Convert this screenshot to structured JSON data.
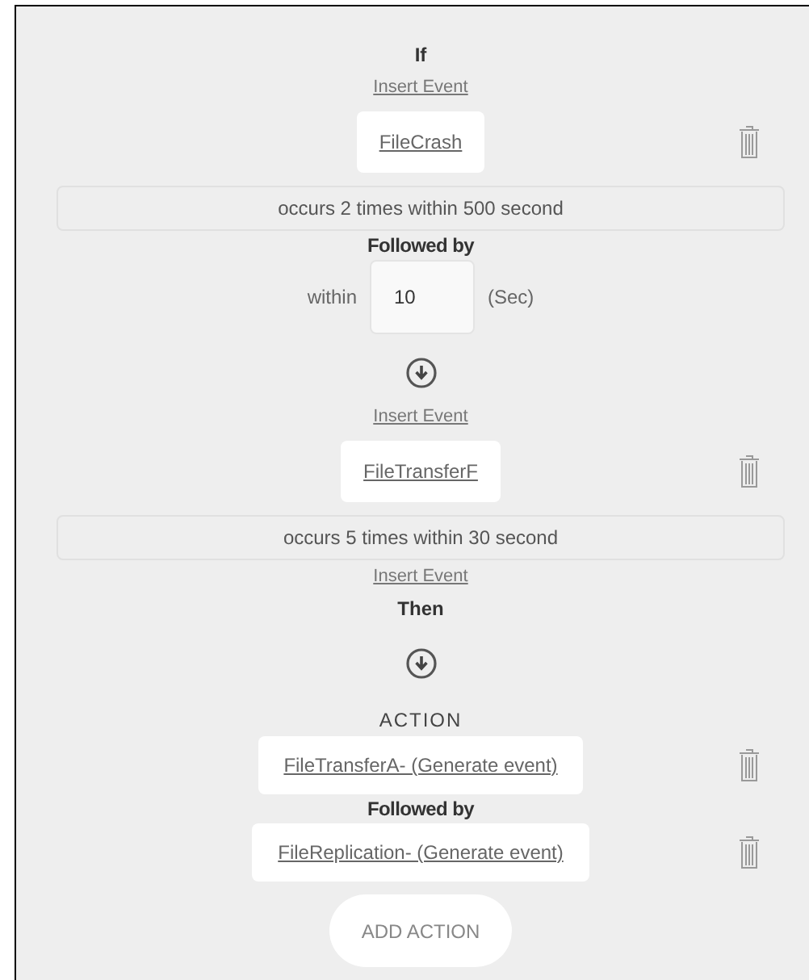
{
  "flow": [
    {
      "kind": "heading",
      "text": "If"
    },
    {
      "kind": "link",
      "text": "Insert Event"
    },
    {
      "kind": "event",
      "text": "FileCrash"
    },
    {
      "kind": "condition",
      "text": "occurs 2 times within 500 second"
    },
    {
      "kind": "subheading",
      "text": "Followed by"
    },
    {
      "kind": "delay",
      "label": "within",
      "value": "10",
      "unit": "(Sec)"
    },
    {
      "kind": "arrow"
    },
    {
      "kind": "link",
      "text": "Insert Event"
    },
    {
      "kind": "event",
      "text": "FileTransferF"
    },
    {
      "kind": "condition",
      "text": "occurs 5 times within 30 second"
    },
    {
      "kind": "link",
      "text": "Insert Event"
    },
    {
      "kind": "heading",
      "text": "Then"
    },
    {
      "kind": "arrow"
    },
    {
      "kind": "title",
      "text": "ACTION"
    },
    {
      "kind": "action",
      "text": "FileTransferA- (Generate event)"
    },
    {
      "kind": "subheading",
      "text": "Followed by"
    },
    {
      "kind": "action",
      "text": "FileReplication- (Generate event)"
    },
    {
      "kind": "button",
      "text": "ADD ACTION"
    }
  ]
}
